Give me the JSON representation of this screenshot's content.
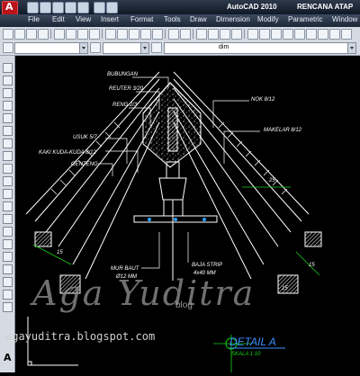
{
  "window": {
    "app_title": "AutoCAD 2010",
    "doc_title": "RENCANA ATAP"
  },
  "menu": [
    "File",
    "Edit",
    "View",
    "Insert",
    "Format",
    "Tools",
    "Draw",
    "Dimension",
    "Modify",
    "Parametric",
    "Window"
  ],
  "layer_combo": {
    "value": "dim"
  },
  "drawing": {
    "labels": {
      "bubungan": "BUBUNGAN",
      "reuter": "REUTER 3/20",
      "reng": "RENG 2/3",
      "usuk": "USUK 5/7",
      "kaki_kuda": "KAKI KUDA-KUDA 8/12",
      "genteng": "GENTENG",
      "nok": "NOK 8/12",
      "makelar": "MAKELAR 8/12",
      "mur_baut_1": "MUR BAUT",
      "mur_baut_2": "Ø12 MM",
      "baja_strip_1": "BAJA STRIP",
      "baja_strip_2": "4x40 MM",
      "dim_25": "25",
      "dim_15a": "15",
      "dim_15b": "15",
      "dim_15c": "15"
    },
    "detail_title": "DETAIL A",
    "scale": "SKALA 1:10"
  },
  "watermark": {
    "name": "Aga Yuditra",
    "url": "agayuditra.blogspot.com",
    "tag": "blog"
  },
  "colors": {
    "drawing_lines": "#ffffff",
    "hatch": "#ffffff",
    "baja_blue": "#2aa0ff",
    "dim_green": "#19d219",
    "detail_title": "#3a8fff"
  }
}
